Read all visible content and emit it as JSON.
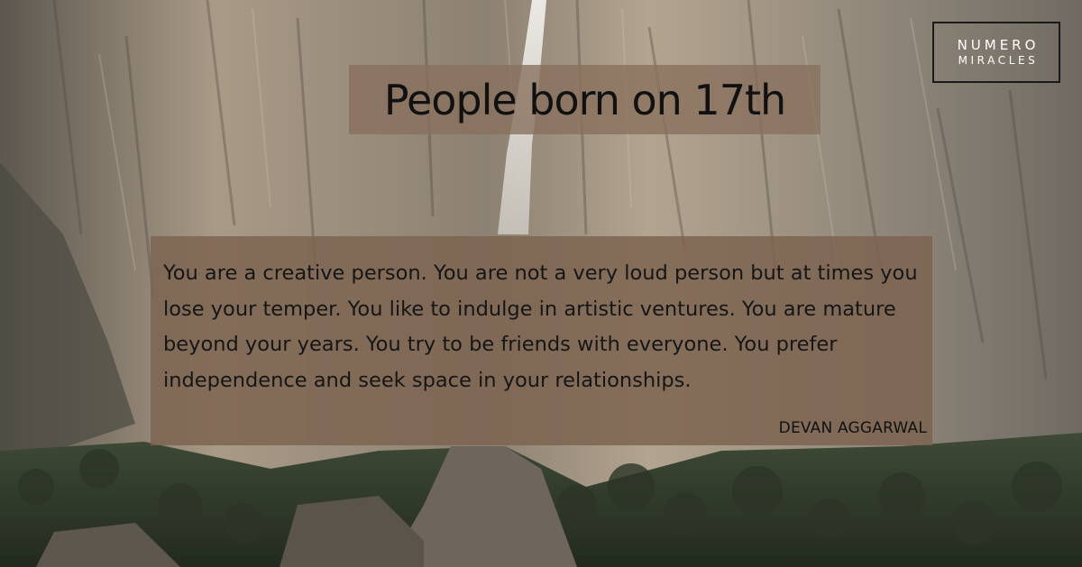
{
  "logo": {
    "line1": "NUMERO",
    "line2": "MIRACLES"
  },
  "title": "People born on 17th",
  "quote": {
    "text": "You are a creative person. You are not a very loud person but at times you lose your temper. You like to indulge in artistic ventures. You are mature beyond your years. You try to be friends with everyone. You prefer independence and seek space in your relationships.",
    "author": "DEVAN AGGARWAL"
  },
  "colors": {
    "title_panel": "#88705c",
    "quote_panel": "#7d6450",
    "text": "#161616",
    "logo_text": "#ffffff"
  }
}
